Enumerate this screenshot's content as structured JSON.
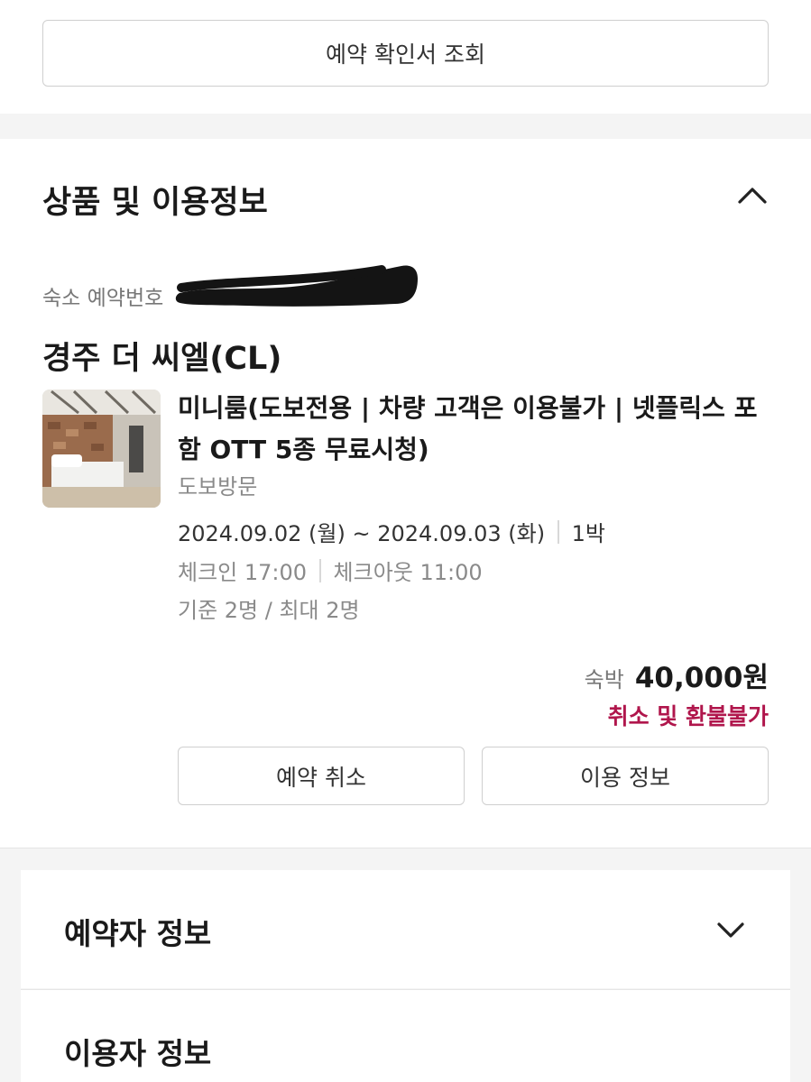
{
  "top": {
    "confirm_button_label": "예약 확인서 조회"
  },
  "product": {
    "section_title": "상품 및 이용정보",
    "collapse_icon": "chevron-up-icon",
    "reservation_number_label": "숙소 예약번호",
    "hotel_name": "경주 더 씨엘(CL)",
    "room_name": "미니룸(도보전용 | 차량 고객은 이용불가 | 넷플릭스 포함 OTT 5종 무료시청)",
    "visit_type": "도보방문",
    "date_range": "2024.09.02 (월) ~ 2024.09.03 (화)",
    "nights": "1박",
    "checkin": "체크인 17:00",
    "checkout": "체크아웃 11:00",
    "capacity": "기준 2명 / 최대 2명",
    "price_label": "숙박",
    "price_value": "40,000원",
    "refund_note": "취소 및 환불불가",
    "cancel_button_label": "예약 취소",
    "usage_button_label": "이용 정보"
  },
  "booker": {
    "title": "예약자 정보",
    "expand_icon": "chevron-down-icon"
  },
  "user": {
    "title": "이용자 정보"
  },
  "colors": {
    "accent_refund": "#b0164c",
    "page_gray": "#f4f4f4",
    "border": "#cfcfcf"
  }
}
